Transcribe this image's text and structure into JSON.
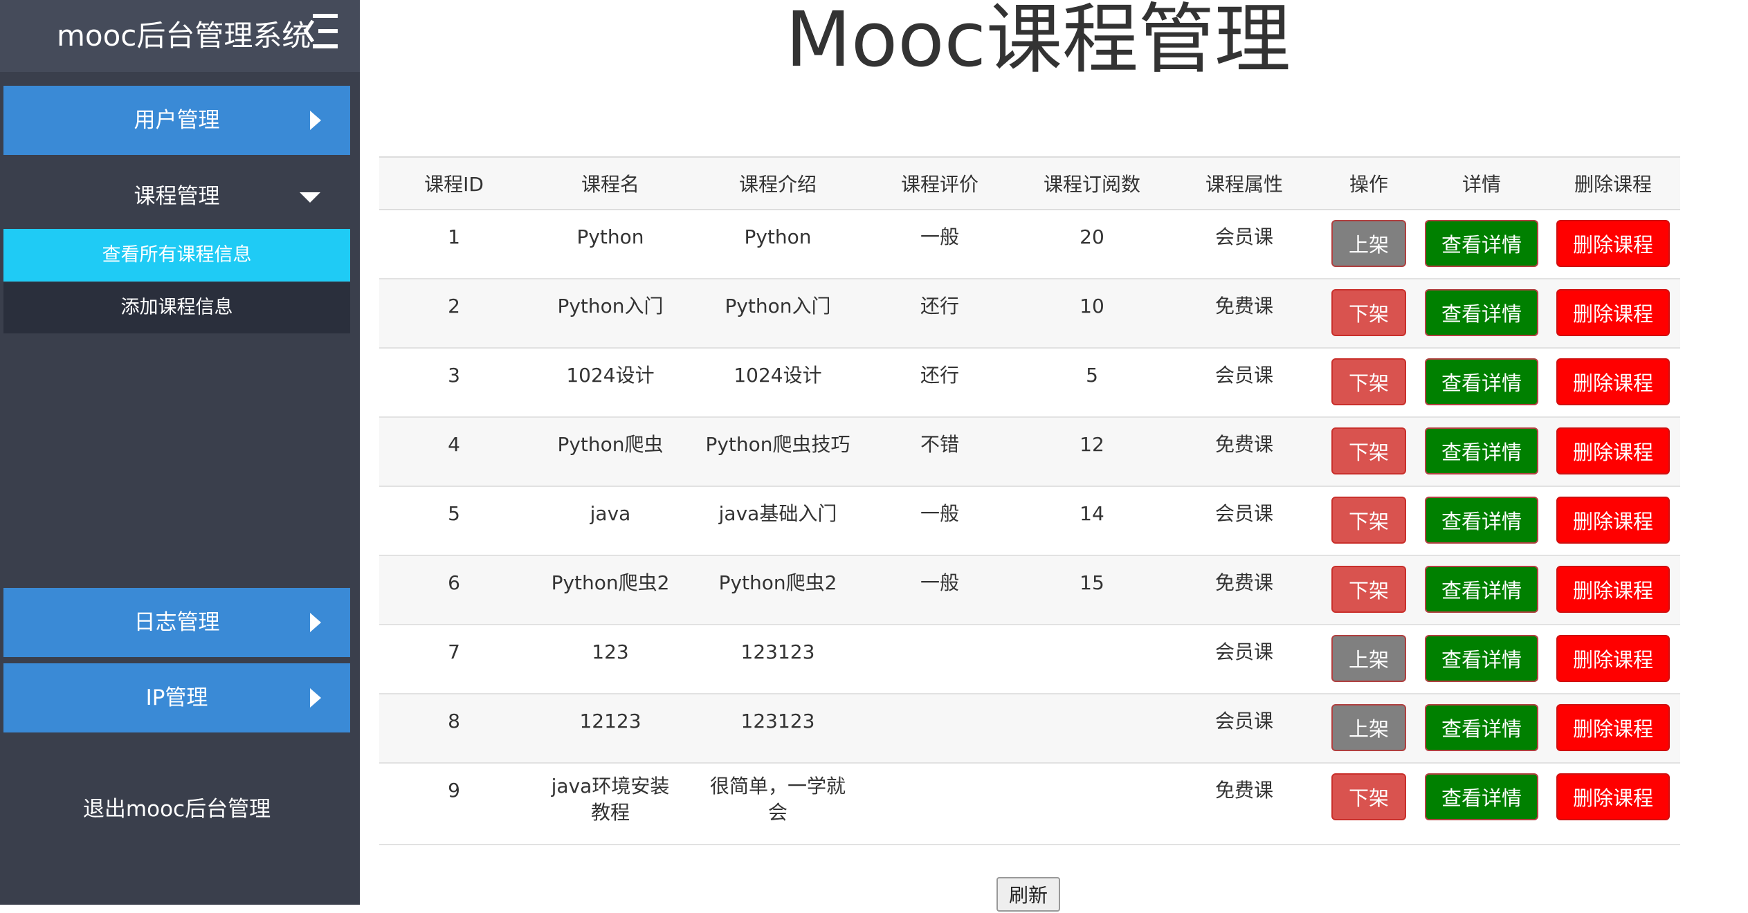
{
  "sidebar": {
    "brand": "mooc后台管理系统",
    "menu_icon": "menu-collapse-icon",
    "items": [
      {
        "label": "用户管理",
        "icon": "arrow-right-icon"
      },
      {
        "label": "课程管理",
        "icon": "arrow-down-icon",
        "children": [
          {
            "label": "查看所有课程信息"
          },
          {
            "label": "添加课程信息"
          }
        ]
      },
      {
        "label": "日志管理",
        "icon": "arrow-right-icon"
      },
      {
        "label": "IP管理",
        "icon": "arrow-right-icon"
      }
    ],
    "logout": "退出mooc后台管理"
  },
  "main": {
    "title": "Mooc课程管理",
    "columns": [
      "课程ID",
      "课程名",
      "课程介绍",
      "课程评价",
      "课程订阅数",
      "课程属性",
      "操作",
      "详情",
      "删除课程"
    ],
    "rows": [
      {
        "id": "1",
        "name": "Python",
        "intro": "Python",
        "rating": "一般",
        "subs": "20",
        "type": "会员课",
        "action": "上架"
      },
      {
        "id": "2",
        "name": "Python入门",
        "intro": "Python入门",
        "rating": "还行",
        "subs": "10",
        "type": "免费课",
        "action": "下架"
      },
      {
        "id": "3",
        "name": "1024设计",
        "intro": "1024设计",
        "rating": "还行",
        "subs": "5",
        "type": "会员课",
        "action": "下架"
      },
      {
        "id": "4",
        "name": "Python爬虫",
        "intro": "Python爬虫技巧",
        "rating": "不错",
        "subs": "12",
        "type": "免费课",
        "action": "下架"
      },
      {
        "id": "5",
        "name": "java",
        "intro": "java基础入门",
        "rating": "一般",
        "subs": "14",
        "type": "会员课",
        "action": "下架"
      },
      {
        "id": "6",
        "name": "Python爬虫2",
        "intro": "Python爬虫2",
        "rating": "一般",
        "subs": "15",
        "type": "免费课",
        "action": "下架"
      },
      {
        "id": "7",
        "name": "123",
        "intro": "123123",
        "rating": "",
        "subs": "",
        "type": "会员课",
        "action": "上架"
      },
      {
        "id": "8",
        "name": "12123",
        "intro": "123123",
        "rating": "",
        "subs": "",
        "type": "会员课",
        "action": "上架"
      },
      {
        "id": "9",
        "name": "java环境安装教程",
        "intro": "很简单，一学就会",
        "rating": "",
        "subs": "",
        "type": "免费课",
        "action": "下架"
      }
    ],
    "detail_label": "查看详情",
    "delete_label": "删除课程",
    "refresh_label": "刷新"
  },
  "colors": {
    "sidebar_bg": "#3a3f4c",
    "nav_blue": "#3a8ad6",
    "sub_active": "#1fcbf5",
    "btn_up": "#808080",
    "btn_down": "#d9534f",
    "btn_detail": "#008000",
    "btn_delete": "#ff0000"
  }
}
